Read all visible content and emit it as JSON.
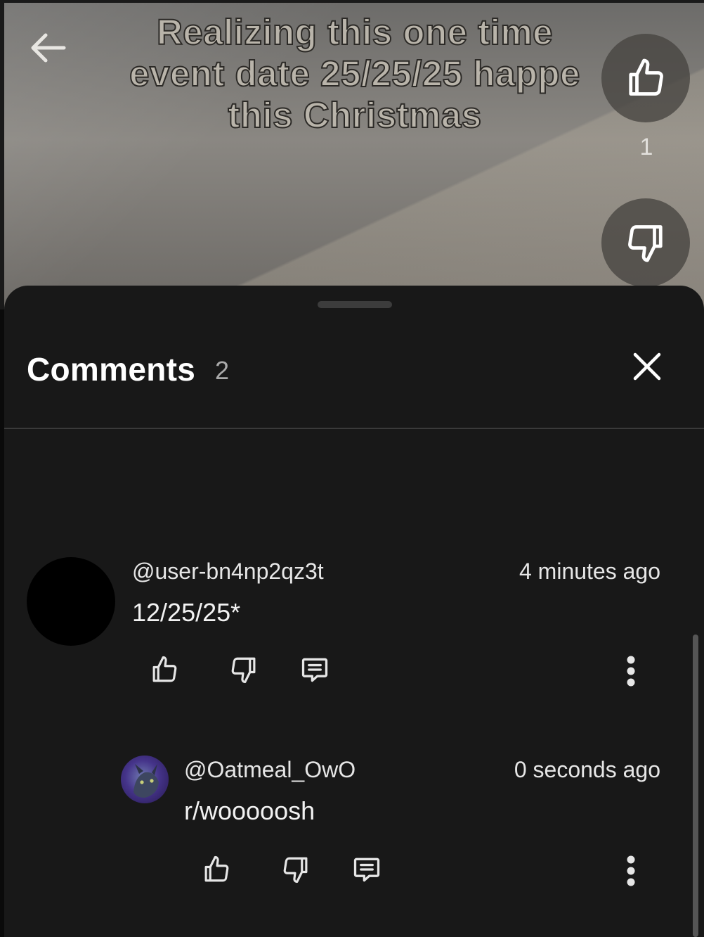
{
  "video": {
    "caption": "Realizing this one time\nevent date 25/25/25 happe\nthis Christmas",
    "like_count": "1",
    "icons": {
      "back": "back-arrow-icon",
      "like": "thumbs-up-icon",
      "dislike": "thumbs-down-icon"
    }
  },
  "sheet": {
    "title": "Comments",
    "count": "2",
    "close_icon": "close-icon"
  },
  "comments": [
    {
      "username": "@user-bn4np2qz3t",
      "time": "4 minutes ago",
      "text": "12/25/25*",
      "avatar_color": "#000000"
    },
    {
      "username": "@Oatmeal_OwO",
      "time": "0 seconds ago",
      "text": "r/wooooosh",
      "avatar_color": "#3b2a6b"
    }
  ],
  "colors": {
    "sheet_bg": "#181818",
    "text_primary": "#ffffff",
    "text_secondary": "#aaaaaa"
  }
}
